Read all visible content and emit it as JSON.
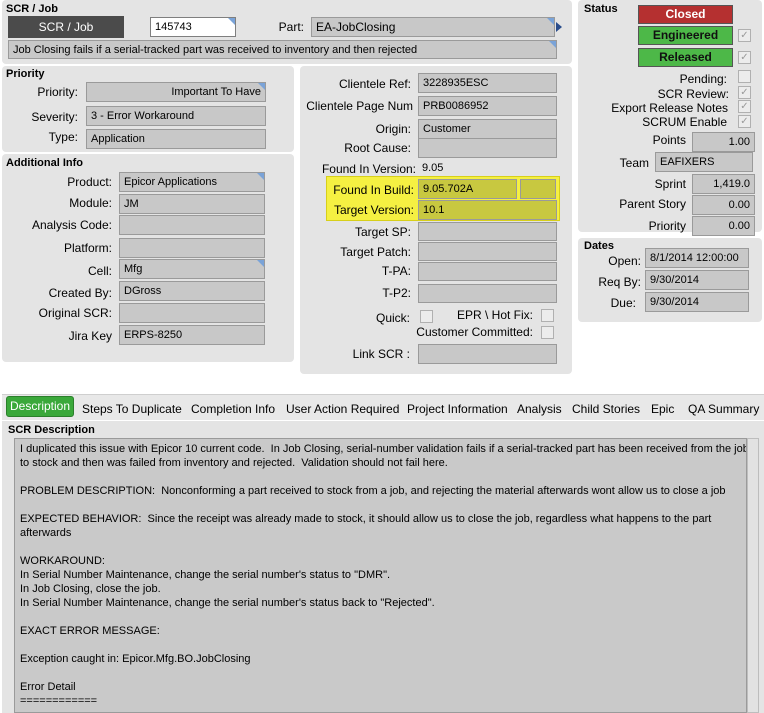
{
  "scr_job": {
    "section_title": "SCR / Job",
    "button_label": "SCR / Job",
    "number": "145743",
    "part_label": "Part:",
    "part_value": "EA-JobClosing",
    "summary": "Job Closing fails if a serial-tracked part was received to inventory and then rejected"
  },
  "priority": {
    "section_title": "Priority",
    "priority_label": "Priority:",
    "priority_value": "Important To Have",
    "severity_label": "Severity:",
    "severity_value": "3 - Error Workaround",
    "type_label": "Type:",
    "type_value": "Application"
  },
  "additional": {
    "section_title": "Additional Info",
    "product_label": "Product:",
    "product_value": "Epicor Applications",
    "module_label": "Module:",
    "module_value": "JM",
    "analysis_label": "Analysis Code:",
    "analysis_value": "",
    "platform_label": "Platform:",
    "platform_value": "",
    "cell_label": "Cell:",
    "cell_value": "Mfg",
    "created_label": "Created By:",
    "created_value": "DGross",
    "original_label": "Original SCR:",
    "original_value": "",
    "jira_label": "Jira Key",
    "jira_value": "ERPS-8250"
  },
  "client": {
    "ref_label": "Clientele Ref:",
    "ref_value": "3228935ESC",
    "page_label": "Clientele Page Num",
    "page_value": "PRB0086952",
    "origin_label": "Origin:",
    "origin_value": "Customer",
    "root_label": "Root Cause:",
    "root_value": "",
    "found_ver_label": "Found In Version:",
    "found_ver_value": "9.05",
    "found_build_label": "Found In Build:",
    "found_build_value": "9.05.702A",
    "target_ver_label": "Target Version:",
    "target_ver_value": "10.1",
    "target_sp_label": "Target SP:",
    "target_patch_label": "Target Patch:",
    "tpa_label": "T-PA:",
    "tp2_label": "T-P2:",
    "quick_label": "Quick:",
    "epr_label": "EPR \\ Hot Fix:",
    "committed_label": "Customer Committed:",
    "link_label": "Link SCR :"
  },
  "status": {
    "section_title": "Status",
    "closed_label": "Closed",
    "engineered_label": "Engineered",
    "released_label": "Released",
    "pending_label": "Pending:",
    "scr_review_label": "SCR Review:",
    "export_label": "Export Release Notes",
    "scrum_label": "SCRUM Enable",
    "points_label": "Points",
    "points_value": "1.00",
    "team_label": "Team",
    "team_value": "EAFIXERS",
    "sprint_label": "Sprint",
    "sprint_value": "1,419.0",
    "parent_label": "Parent Story",
    "parent_value": "0.00",
    "priority_label": "Priority",
    "priority_value": "0.00"
  },
  "dates": {
    "section_title": "Dates",
    "open_label": "Open:",
    "open_value": "8/1/2014 12:00:00",
    "req_label": "Req By:",
    "req_value": "9/30/2014",
    "due_label": "Due:",
    "due_value": "9/30/2014"
  },
  "tabs": [
    "Description",
    "Steps To Duplicate",
    "Completion Info",
    "User Action Required",
    "Project Information",
    "Analysis",
    "Child Stories",
    "Epic",
    "QA Summary"
  ],
  "description": {
    "title": "SCR Description",
    "lines": [
      "I duplicated this issue with Epicor 10 current code.  In Job Closing, serial-number validation fails if a serial-tracked part has been received from the job",
      "to stock and then was failed from inventory and rejected.  Validation should not fail here.",
      "",
      "PROBLEM DESCRIPTION:  Nonconforming a part received to stock from a job, and rejecting the material afterwards wont allow us to close a job",
      "",
      "EXPECTED BEHAVIOR:  Since the receipt was already made to stock, it should allow us to close the job, regardless what happens to the part",
      "afterwards",
      "",
      "WORKAROUND:",
      "In Serial Number Maintenance, change the serial number's status to \"DMR\".",
      "In Job Closing, close the job.",
      "In Serial Number Maintenance, change the serial number's status back to \"Rejected\".",
      "",
      "EXACT ERROR MESSAGE:",
      "",
      "Exception caught in: Epicor.Mfg.BO.JobClosing",
      "",
      "Error Detail",
      "============"
    ]
  },
  "colors": {
    "closed": "#b53030",
    "engineered": "#4db848",
    "released": "#4db848",
    "highlight": "#f5f042",
    "active_tab": "#3aa83a"
  }
}
